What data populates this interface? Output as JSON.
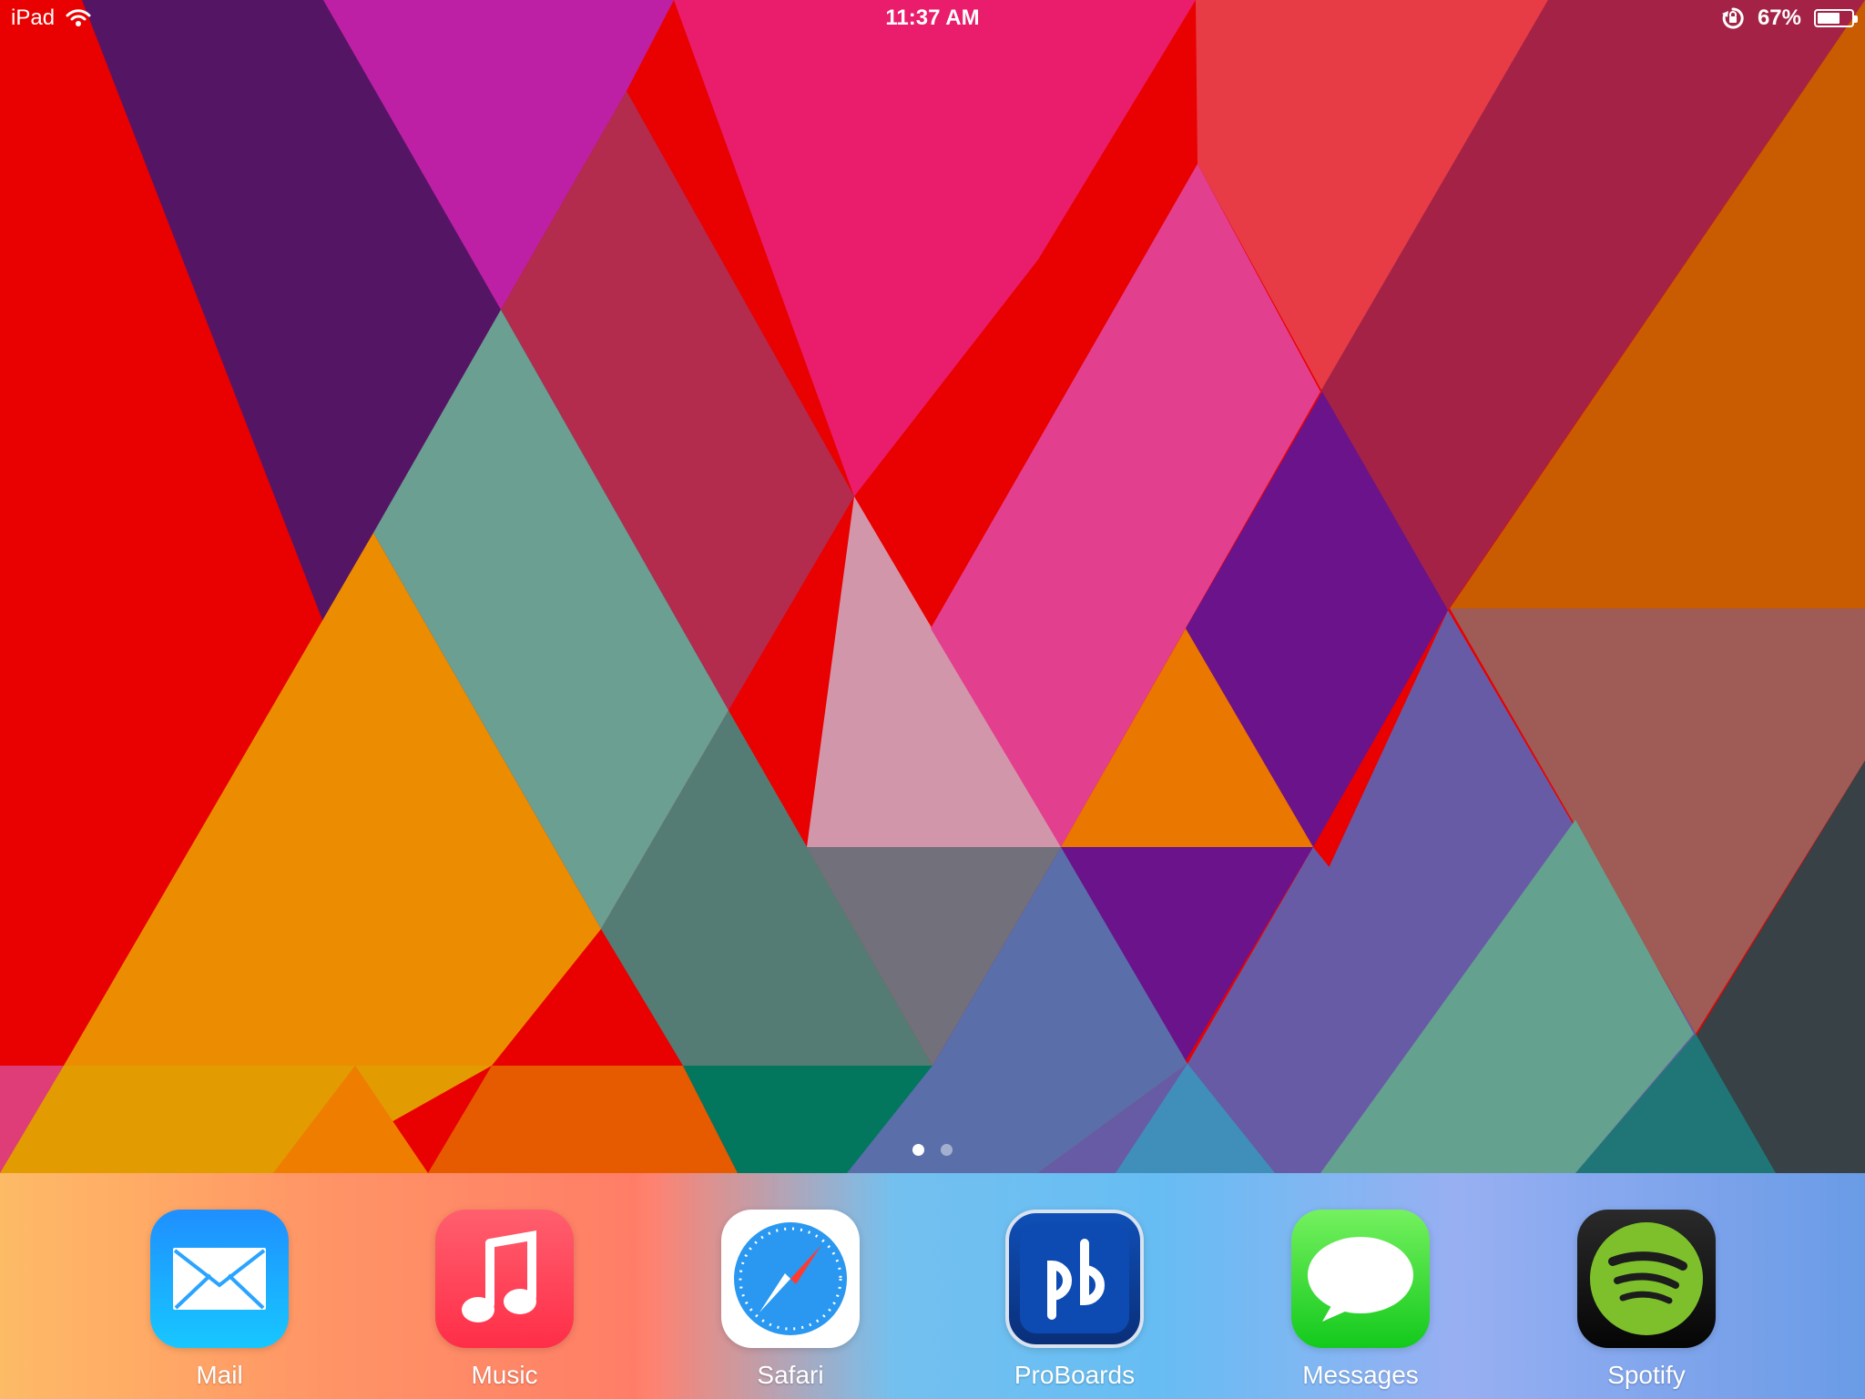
{
  "status_bar": {
    "device": "iPad",
    "time": "11:37 AM",
    "battery_percent": "67%",
    "battery_level": 0.67,
    "icons": [
      "wifi-icon",
      "rotation-lock-icon",
      "battery-icon"
    ]
  },
  "home_screen": {
    "page_count": 2,
    "active_page": 1
  },
  "dock": {
    "apps": [
      {
        "label": "Mail",
        "icon": "mail-icon"
      },
      {
        "label": "Music",
        "icon": "music-icon"
      },
      {
        "label": "Safari",
        "icon": "safari-icon"
      },
      {
        "label": "ProBoards",
        "icon": "proboards-icon"
      },
      {
        "label": "Messages",
        "icon": "messages-icon"
      },
      {
        "label": "Spotify",
        "icon": "spotify-icon"
      }
    ]
  },
  "colors": {
    "wallpaper": [
      "#e90000",
      "#551565",
      "#bd20a5",
      "#e91d6c",
      "#e73c46",
      "#a42246",
      "#c95b00",
      "#6a9f92",
      "#ec8c00",
      "#d296aa",
      "#e33f8f",
      "#6b138a",
      "#685ba5",
      "#9f5b55",
      "#374146",
      "#02775e"
    ],
    "accent_white": "#ffffff"
  }
}
